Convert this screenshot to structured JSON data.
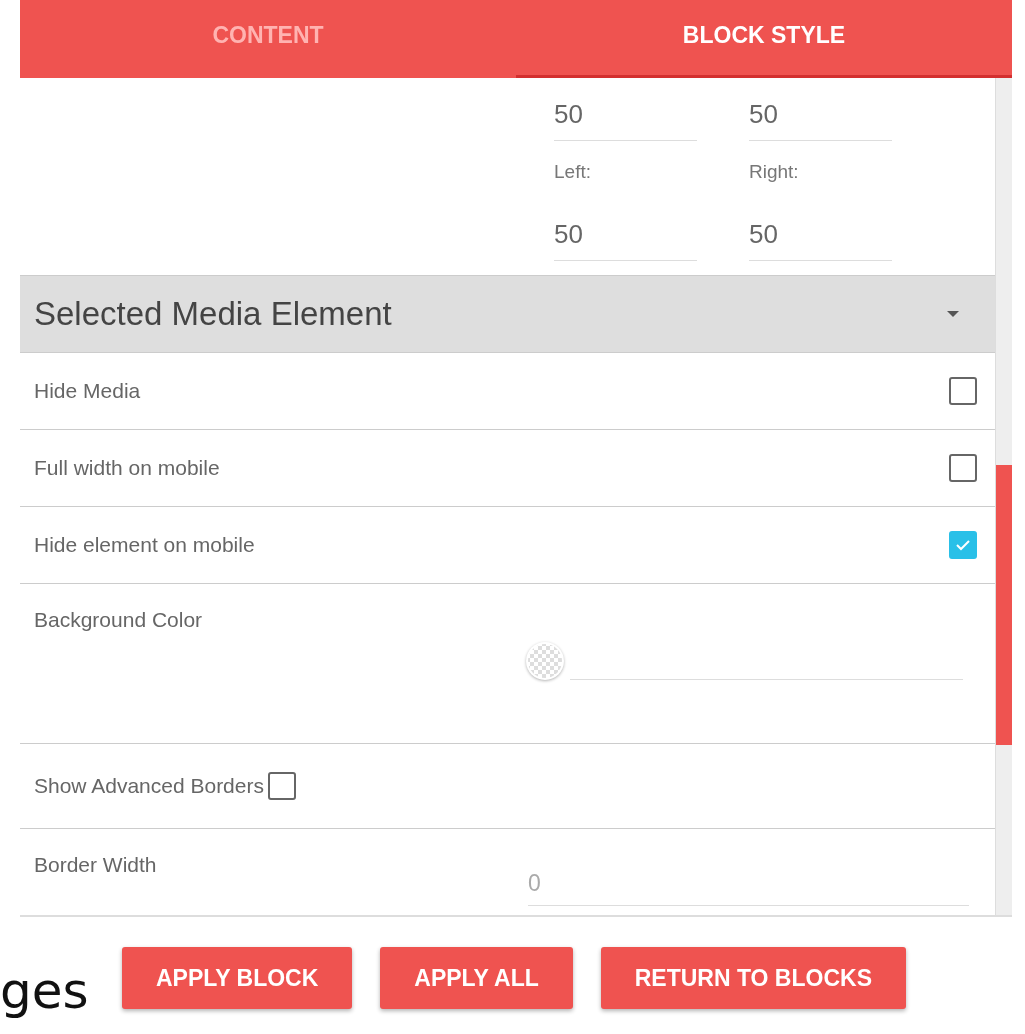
{
  "tabs": [
    {
      "label": "CONTENT",
      "selected": false
    },
    {
      "label": "BLOCK STYLE",
      "selected": true
    }
  ],
  "spacing": [
    {
      "kind": "field",
      "value": "50"
    },
    {
      "kind": "field",
      "value": "50"
    },
    {
      "kind": "label",
      "text": "Left:"
    },
    {
      "kind": "label",
      "text": "Right:"
    },
    {
      "kind": "field",
      "value": "50"
    },
    {
      "kind": "field",
      "value": "50"
    }
  ],
  "section": {
    "title": "Selected Media Element"
  },
  "rows": [
    {
      "kind": "checkbox",
      "label": "Hide Media",
      "checked": false
    },
    {
      "kind": "checkbox",
      "label": "Full width on mobile",
      "checked": false
    },
    {
      "kind": "checkbox",
      "label": "Hide element on mobile",
      "checked": true
    },
    {
      "kind": "color",
      "label": "Background Color"
    },
    {
      "kind": "inline_checkbox",
      "label": "Show Advanced Borders",
      "checked": false
    },
    {
      "kind": "number",
      "label": "Border Width",
      "placeholder": "0"
    }
  ],
  "buttons": [
    "APPLY BLOCK",
    "APPLY ALL",
    "RETURN TO BLOCKS"
  ],
  "background_text": "ges"
}
